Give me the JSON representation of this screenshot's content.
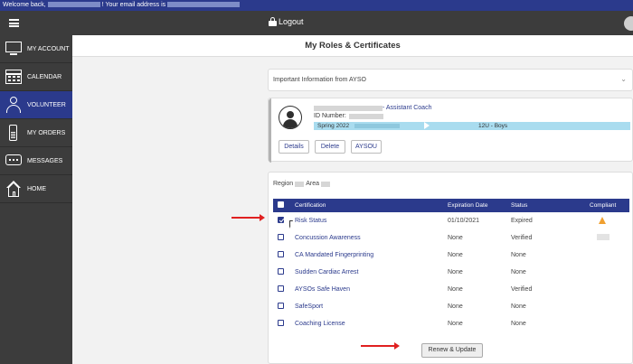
{
  "welcome": {
    "prefix": "Welcome back,",
    "middle": "! Your email address is"
  },
  "topbar": {
    "logout_label": "Logout"
  },
  "sidebar": {
    "items": [
      {
        "label": "MY ACCOUNT",
        "icon": "monitor-icon"
      },
      {
        "label": "CALENDAR",
        "icon": "calendar-icon"
      },
      {
        "label": "VOLUNTEER",
        "icon": "volunteer-icon",
        "active": true
      },
      {
        "label": "MY ORDERS",
        "icon": "phone-icon"
      },
      {
        "label": "MESSAGES",
        "icon": "message-icon"
      },
      {
        "label": "HOME",
        "icon": "home-icon"
      }
    ]
  },
  "page": {
    "title": "My Roles & Certificates"
  },
  "info_panel": {
    "text": "Important Information from AYSO",
    "chevron": "⌄"
  },
  "role": {
    "role_suffix": "- Assistant Coach",
    "id_label": "ID Number:",
    "season": "Spring 2022",
    "division": "12U - Boys",
    "buttons": {
      "details": "Details",
      "delete": "Delete",
      "aysou": "AYSOU"
    }
  },
  "certs": {
    "region_label": "Region",
    "area_label": "Area",
    "headers": {
      "certification": "Certification",
      "expiration": "Expiration Date",
      "status": "Status",
      "compliant": "Compliant"
    },
    "rows": [
      {
        "name": "Risk Status",
        "expiration": "01/10/2021",
        "status": "Expired",
        "checked": true,
        "compliant": "warning-icon"
      },
      {
        "name": "Concussion Awareness",
        "expiration": "None",
        "status": "Verified",
        "checked": false,
        "compliant": "blank"
      },
      {
        "name": "CA Mandated Fingerprinting",
        "expiration": "None",
        "status": "None",
        "checked": false
      },
      {
        "name": "Sudden Cardiac Arrest",
        "expiration": "None",
        "status": "None",
        "checked": false
      },
      {
        "name": "AYSOs Safe Haven",
        "expiration": "None",
        "status": "Verified",
        "checked": false
      },
      {
        "name": "SafeSport",
        "expiration": "None",
        "status": "None",
        "checked": false
      },
      {
        "name": "Coaching License",
        "expiration": "None",
        "status": "None",
        "checked": false
      }
    ],
    "renew_button": "Renew & Update"
  },
  "colors": {
    "primary": "#2b3a8c",
    "sidebar": "#3c3c3c",
    "role_bar": "#a9dcef",
    "warning": "#f0a030",
    "annotation_arrow": "#e02020"
  }
}
